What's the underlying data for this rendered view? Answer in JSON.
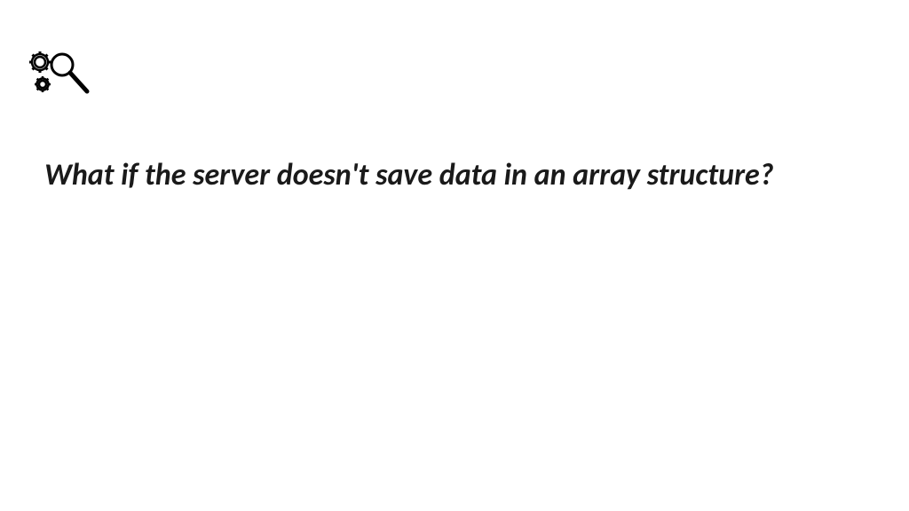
{
  "slide": {
    "heading": "What if the server doesn't save data in an array structure?",
    "icon": "gears-magnifier-icon"
  }
}
